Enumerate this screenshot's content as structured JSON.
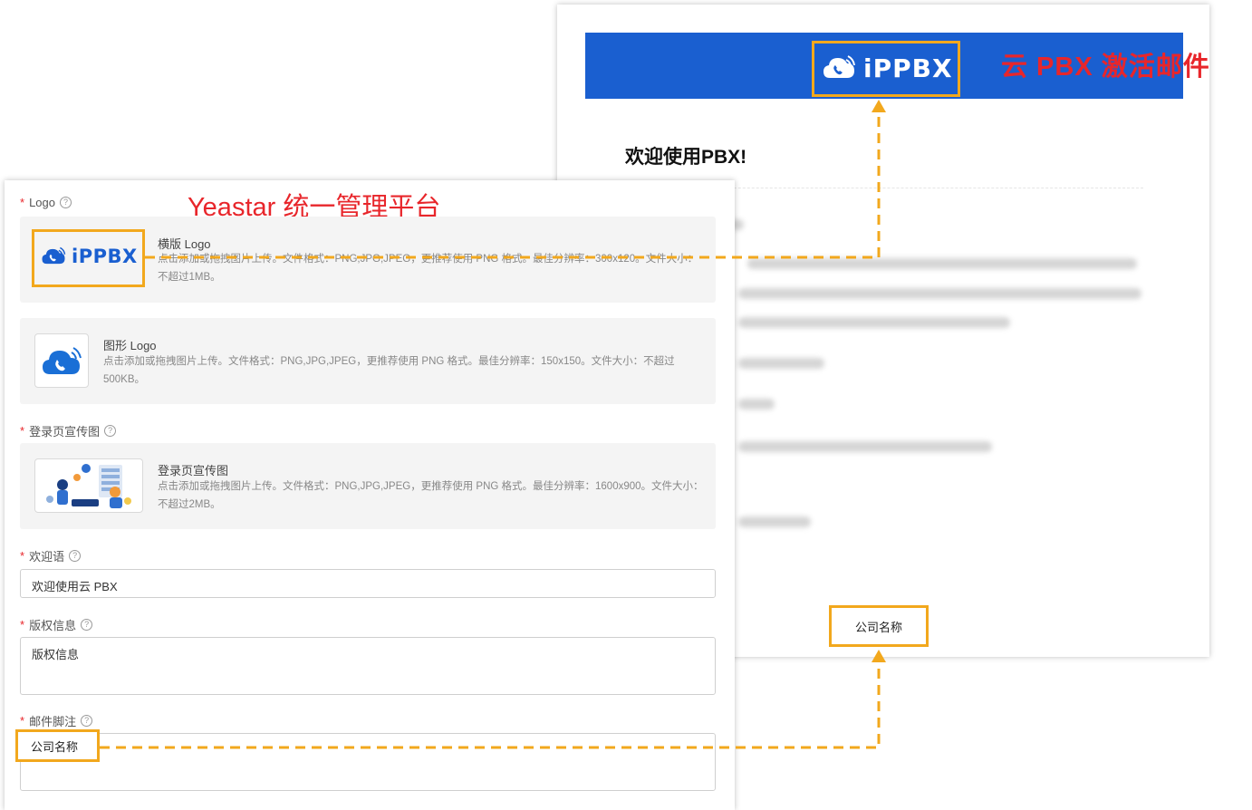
{
  "email": {
    "header_title": "云 PBX 激活邮件",
    "logo_text": "iPPBX",
    "welcome": "欢迎使用PBX!",
    "footer": "公司名称"
  },
  "settings": {
    "platform_title": "Yeastar 统一管理平台",
    "logo_label": "Logo",
    "horizontal_logo": {
      "title": "横版 Logo",
      "desc": "点击添加或拖拽图片上传。文件格式：PNG,JPG,JPEG，更推荐使用 PNG 格式。最佳分辨率：300x120。文件大小：不超过1MB。",
      "logo_text": "iPPBX"
    },
    "graphic_logo": {
      "title": "图形 Logo",
      "desc": "点击添加或拖拽图片上传。文件格式：PNG,JPG,JPEG，更推荐使用 PNG 格式。最佳分辨率：150x150。文件大小：不超过500KB。"
    },
    "login_banner_label": "登录页宣传图",
    "login_banner": {
      "title": "登录页宣传图",
      "desc": "点击添加或拖拽图片上传。文件格式：PNG,JPG,JPEG，更推荐使用 PNG 格式。最佳分辨率：1600x900。文件大小：不超过2MB。"
    },
    "welcome_label": "欢迎语",
    "welcome_value": "欢迎使用云 PBX",
    "copyright_label": "版权信息",
    "copyright_value": "版权信息",
    "mail_footer_label": "邮件脚注",
    "mail_footer_value": "公司名称"
  },
  "colors": {
    "accent_orange": "#f2a81d",
    "brand_blue": "#1a5fd0",
    "annotation_red": "#e8262b"
  },
  "icons": [
    "cloud-phone-icon",
    "help-icon",
    "login-illustration"
  ]
}
